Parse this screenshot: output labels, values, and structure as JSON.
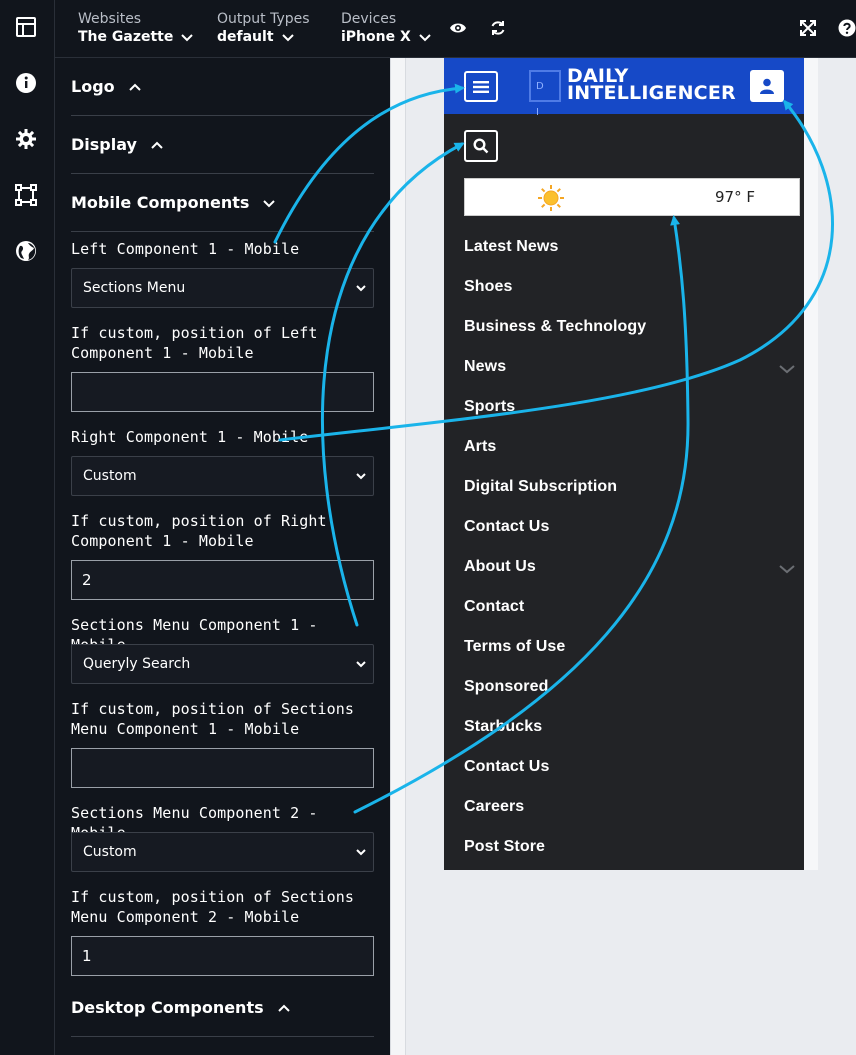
{
  "rail": {
    "icons": [
      "table-icon",
      "info-icon",
      "gear-icon",
      "frame-icon",
      "globe-icon"
    ]
  },
  "topbar": {
    "websites_label": "Websites",
    "websites_value": "The Gazette",
    "output_label": "Output Types",
    "output_value": "default",
    "devices_label": "Devices",
    "devices_value": "iPhone X",
    "icons": [
      "eye-icon",
      "refresh-icon",
      "expand-icon",
      "help-icon"
    ]
  },
  "panel": {
    "logo": "Logo",
    "display": "Display",
    "mobile_components": "Mobile Components",
    "left_comp_label": "Left Component 1 - Mobile",
    "left_comp_value": "Sections Menu",
    "left_custom_label": "If custom, position of Left Component 1 - Mobile",
    "left_custom_value": "",
    "right_comp_label": "Right Component 1 - Mobile",
    "right_comp_value": "Custom",
    "right_custom_label": "If custom, position of Right Component 1 - Mobile",
    "right_custom_value": "2",
    "sm1_label": "Sections Menu Component 1 - Mobile",
    "sm1_value": "Queryly Search",
    "sm1_custom_label": "If custom, position of Sections Menu Component 1 - Mobile",
    "sm1_custom_value": "",
    "sm2_label": "Sections Menu Component 2 - Mobile",
    "sm2_value": "Custom",
    "sm2_custom_label": "If custom, position of Sections Menu Component 2 - Mobile",
    "sm2_custom_value": "1",
    "desktop_components": "Desktop Components"
  },
  "phone": {
    "logo_line1": "DAILY",
    "logo_line2": "INTELLIGENCER",
    "logo_mark": "D I",
    "temperature": "97° F",
    "nav": [
      {
        "label": "Latest News",
        "expandable": false
      },
      {
        "label": "Shoes",
        "expandable": false
      },
      {
        "label": "Business & Technology",
        "expandable": false
      },
      {
        "label": "News",
        "expandable": true
      },
      {
        "label": "Sports",
        "expandable": false
      },
      {
        "label": "Arts",
        "expandable": false
      },
      {
        "label": "Digital Subscription",
        "expandable": false
      },
      {
        "label": "Contact Us",
        "expandable": false
      },
      {
        "label": "About Us",
        "expandable": true
      },
      {
        "label": "Contact",
        "expandable": false
      },
      {
        "label": "Terms of Use",
        "expandable": false
      },
      {
        "label": "Sponsored",
        "expandable": false
      },
      {
        "label": "Starbucks",
        "expandable": false
      },
      {
        "label": "Contact Us",
        "expandable": false
      },
      {
        "label": "Careers",
        "expandable": false
      },
      {
        "label": "Post Store",
        "expandable": false
      }
    ]
  },
  "colors": {
    "dark_bg": "#11151c",
    "brand_blue": "#1649c7",
    "annotation_arrow": "#1ab4ea",
    "phone_bg": "#222326"
  }
}
